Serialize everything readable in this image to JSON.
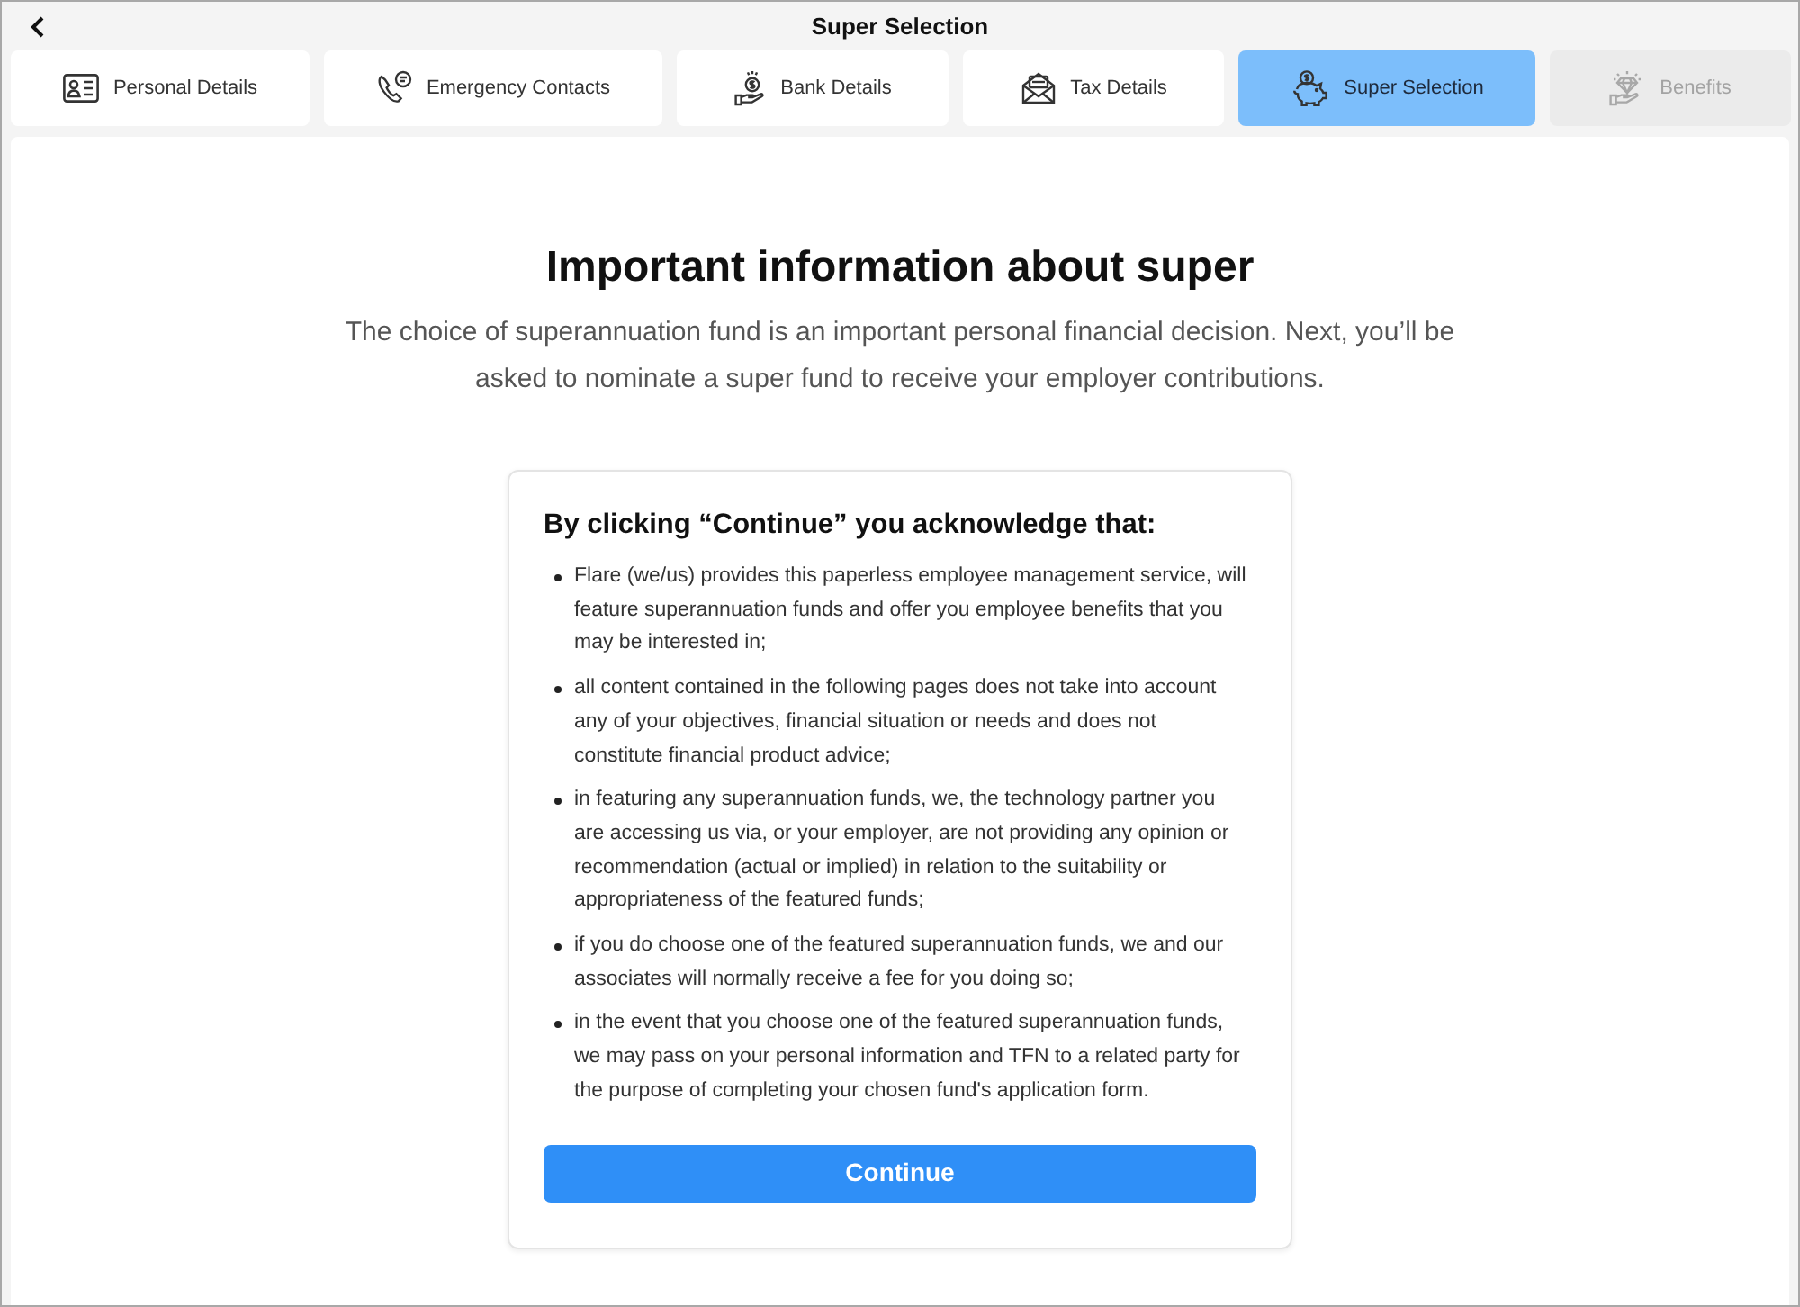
{
  "header": {
    "title": "Super Selection"
  },
  "tabs": [
    {
      "label": "Personal Details",
      "selected": false,
      "disabled": false
    },
    {
      "label": "Emergency Contacts",
      "selected": false,
      "disabled": false
    },
    {
      "label": "Bank Details",
      "selected": false,
      "disabled": false
    },
    {
      "label": "Tax Details",
      "selected": false,
      "disabled": false
    },
    {
      "label": "Super Selection",
      "selected": true,
      "disabled": false
    },
    {
      "label": "Benefits",
      "selected": false,
      "disabled": true
    }
  ],
  "main": {
    "heading": "Important information about super",
    "intro": "The choice of superannuation fund is an important personal financial decision. Next, you’ll be asked to nominate a super fund to receive your employer contributions.",
    "acknowledgement": {
      "heading": "By clicking “Continue” you acknowledge that:",
      "items": [
        "Flare (we/us) provides this paperless employee management service, will feature superannuation funds and offer you employee benefits that you may be interested in;",
        "all content contained in the following pages does not take into account any of your objectives, financial situation or needs and does not constitute financial product advice;",
        "in featuring any superannuation funds, we, the technology partner you are accessing us via, or your employer, are not providing any opinion or recommendation (actual or implied) in relation to the suitability or appropriateness of the featured funds;",
        "if you do choose one of the featured superannuation funds, we and our associates will normally receive a fee for you doing so;",
        "in the event that you choose one of the featured superannuation funds, we may pass on your personal information and TFN to a related party for the purpose of completing your chosen fund's application form."
      ],
      "button": "Continue"
    }
  }
}
